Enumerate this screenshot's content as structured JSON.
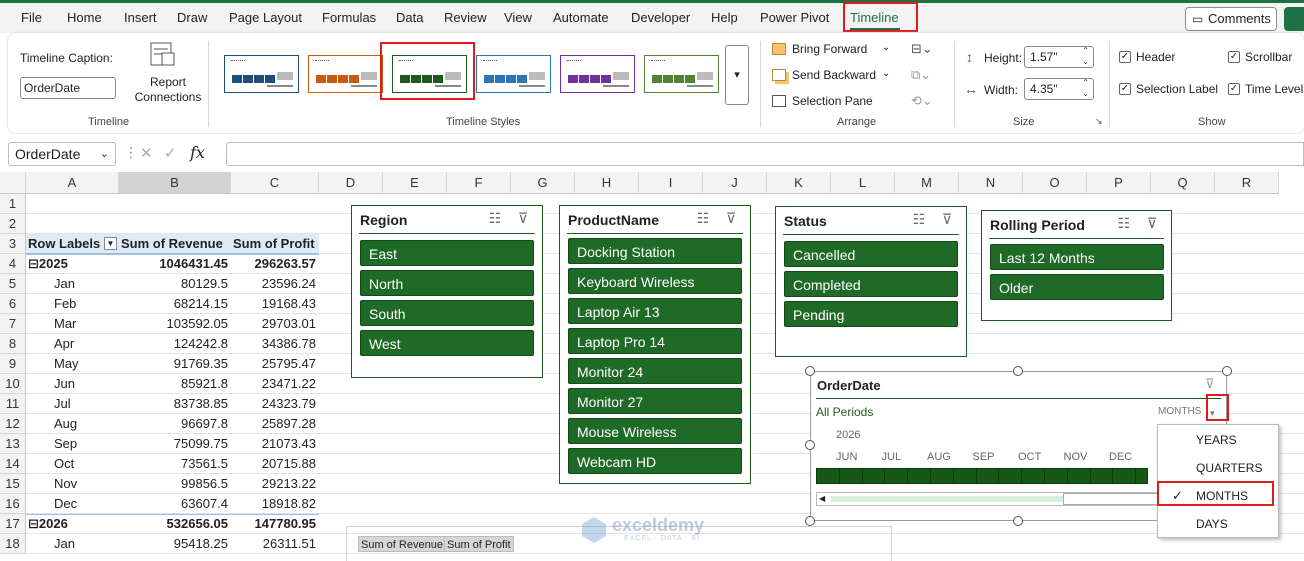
{
  "menu": {
    "tabs": [
      "File",
      "Home",
      "Insert",
      "Draw",
      "Page Layout",
      "Formulas",
      "Data",
      "Review",
      "View",
      "Automate",
      "Developer",
      "Help",
      "Power Pivot",
      "Timeline"
    ],
    "comments_label": "Comments"
  },
  "ribbon": {
    "timeline_group": {
      "caption_label": "Timeline Caption:",
      "caption_value": "OrderDate",
      "report_connections": "Report Connections",
      "group_label": "Timeline"
    },
    "styles_group": {
      "group_label": "Timeline Styles",
      "colors": [
        "#1f4e79",
        "#c55a11",
        "#1e5a1e",
        "#2e75b6",
        "#7030a0",
        "#548235"
      ]
    },
    "arrange_group": {
      "bring_forward": "Bring Forward",
      "send_backward": "Send Backward",
      "selection_pane": "Selection Pane",
      "group_label": "Arrange"
    },
    "size_group": {
      "height_label": "Height:",
      "height_value": "1.57\"",
      "width_label": "Width:",
      "width_value": "4.35\"",
      "group_label": "Size"
    },
    "show_group": {
      "header": "Header",
      "scrollbar": "Scrollbar",
      "selection_label": "Selection Label",
      "time_level": "Time Level",
      "group_label": "Show"
    }
  },
  "formula_bar": {
    "name_box": "OrderDate",
    "fx": "fx"
  },
  "grid": {
    "columns": [
      "A",
      "B",
      "C",
      "D",
      "E",
      "F",
      "G",
      "H",
      "I",
      "J",
      "K",
      "L",
      "M",
      "N",
      "O",
      "P",
      "Q",
      "R"
    ],
    "rows": [
      "1",
      "2",
      "3",
      "4",
      "5",
      "6",
      "7",
      "8",
      "9",
      "10",
      "11",
      "12",
      "13",
      "14",
      "15",
      "16",
      "17",
      "18"
    ],
    "pivot": {
      "headers": [
        "Row Labels",
        "Sum of Revenue",
        "Sum of Profit"
      ],
      "rows": [
        {
          "label": "⊟2025",
          "revenue": "1046431.45",
          "profit": "296263.57",
          "bold": true
        },
        {
          "label": "Jan",
          "revenue": "80129.5",
          "profit": "23596.24"
        },
        {
          "label": "Feb",
          "revenue": "68214.15",
          "profit": "19168.43"
        },
        {
          "label": "Mar",
          "revenue": "103592.05",
          "profit": "29703.01"
        },
        {
          "label": "Apr",
          "revenue": "124242.8",
          "profit": "34386.78"
        },
        {
          "label": "May",
          "revenue": "91769.35",
          "profit": "25795.47"
        },
        {
          "label": "Jun",
          "revenue": "85921.8",
          "profit": "23471.22"
        },
        {
          "label": "Jul",
          "revenue": "83738.85",
          "profit": "24323.79"
        },
        {
          "label": "Aug",
          "revenue": "96697.8",
          "profit": "25897.28"
        },
        {
          "label": "Sep",
          "revenue": "75099.75",
          "profit": "21073.43"
        },
        {
          "label": "Oct",
          "revenue": "73561.5",
          "profit": "20715.88"
        },
        {
          "label": "Nov",
          "revenue": "99856.5",
          "profit": "29213.22"
        },
        {
          "label": "Dec",
          "revenue": "63607.4",
          "profit": "18918.82"
        },
        {
          "label": "⊟2026",
          "revenue": "532656.05",
          "profit": "147780.95",
          "bold": true
        },
        {
          "label": "Jan",
          "revenue": "95418.25",
          "profit": "26311.51"
        }
      ]
    }
  },
  "slicers": {
    "region": {
      "title": "Region",
      "items": [
        "East",
        "North",
        "South",
        "West"
      ]
    },
    "product": {
      "title": "ProductName",
      "items": [
        "Docking Station",
        "Keyboard Wireless",
        "Laptop Air 13",
        "Laptop Pro 14",
        "Monitor 24",
        "Monitor 27",
        "Mouse Wireless",
        "Webcam HD"
      ]
    },
    "status": {
      "title": "Status",
      "items": [
        "Cancelled",
        "Completed",
        "Pending"
      ]
    },
    "rolling": {
      "title": "Rolling Period",
      "items": [
        "Last 12 Months",
        "Older"
      ]
    }
  },
  "timeline": {
    "title": "OrderDate",
    "all_periods": "All Periods",
    "level": "MONTHS",
    "year": "2026",
    "months": [
      "JUN",
      "JUL",
      "AUG",
      "SEP",
      "OCT",
      "NOV",
      "DEC"
    ]
  },
  "level_menu": {
    "items": [
      "YEARS",
      "QUARTERS",
      "MONTHS",
      "DAYS"
    ],
    "selected": "MONTHS"
  },
  "chart_buttons": {
    "revenue": "Sum of Revenue",
    "profit": "Sum of Profit"
  },
  "watermark": {
    "name": "exceldemy",
    "tagline": "EXCEL · DATA · BI"
  }
}
